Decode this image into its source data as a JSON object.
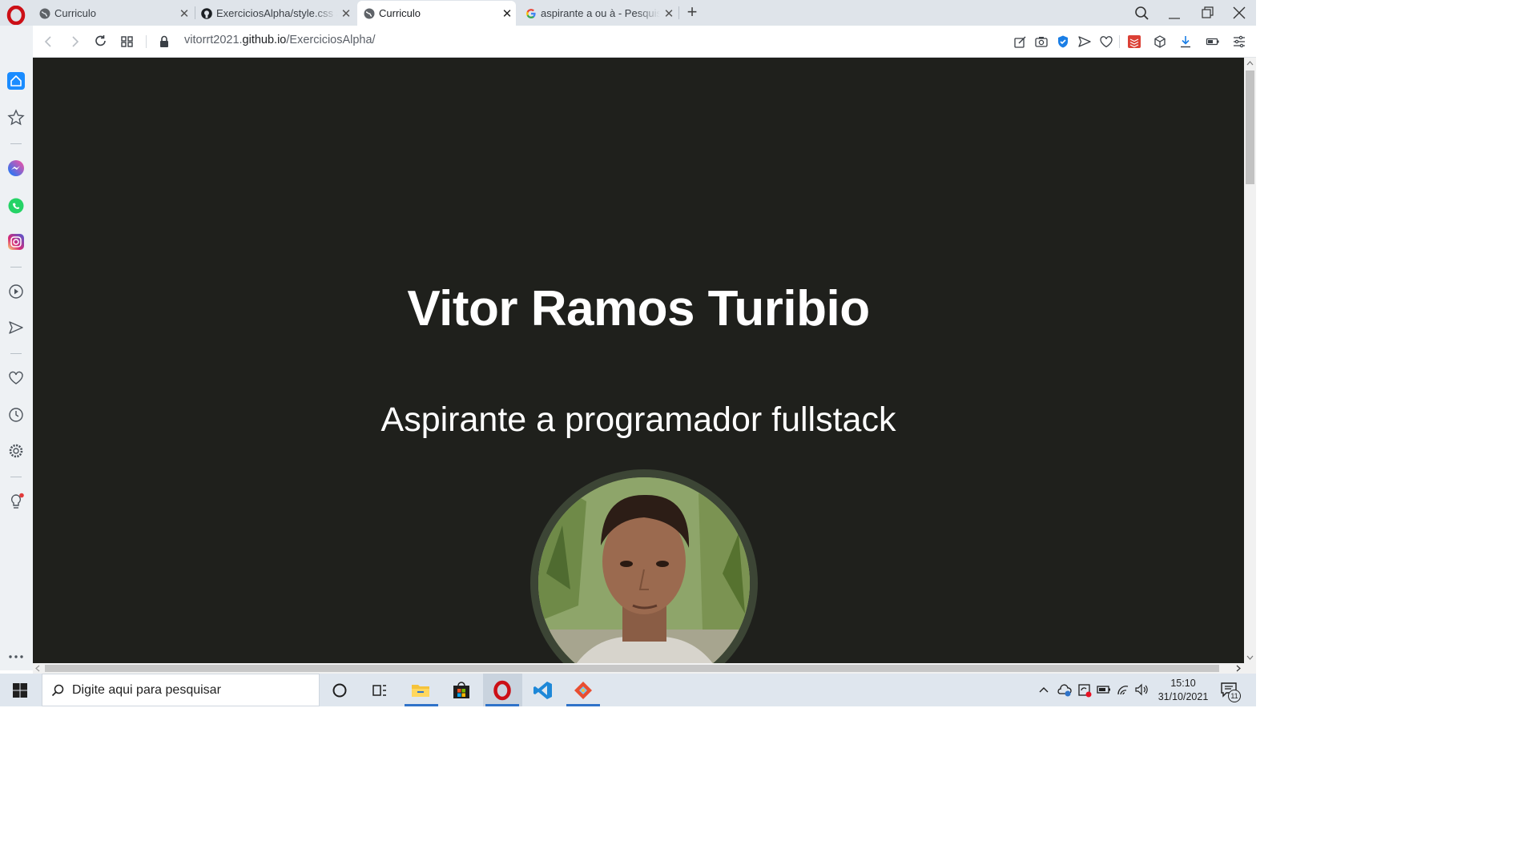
{
  "browser": {
    "tabs": [
      {
        "title": "Curriculo",
        "favicon": "globe-icon",
        "active": false
      },
      {
        "title": "ExerciciosAlpha/style.css at",
        "favicon": "github-icon",
        "active": false
      },
      {
        "title": "Curriculo",
        "favicon": "globe-icon",
        "active": true
      },
      {
        "title": "aspirante a ou à - Pesquisa",
        "favicon": "google-icon",
        "active": false
      }
    ],
    "url": {
      "prefix": "vitorrt2021.",
      "domain": "github.io",
      "path": "/ExerciciosAlpha/"
    },
    "accent_color": "#cc0f16",
    "sidebar_icons": [
      "home-icon",
      "speed-dial-icon",
      "messenger-icon",
      "whatsapp-icon",
      "instagram-icon",
      "player-icon",
      "flow-icon",
      "bookmarks-icon",
      "history-icon",
      "settings-icon",
      "tips-icon",
      "more-icon"
    ]
  },
  "page": {
    "background": "#1f201c",
    "name": "Vitor Ramos Turibio",
    "subtitle": "Aspirante a programador fullstack",
    "avatar_ring_color": "#3c4535"
  },
  "taskbar": {
    "search_placeholder": "Digite aqui para pesquisar",
    "time": "15:10",
    "date": "31/10/2021",
    "notification_count": "11",
    "apps": [
      "cortana-icon",
      "task-view-icon",
      "file-explorer-icon",
      "store-icon",
      "opera-icon",
      "vscode-icon",
      "git-icon"
    ]
  }
}
